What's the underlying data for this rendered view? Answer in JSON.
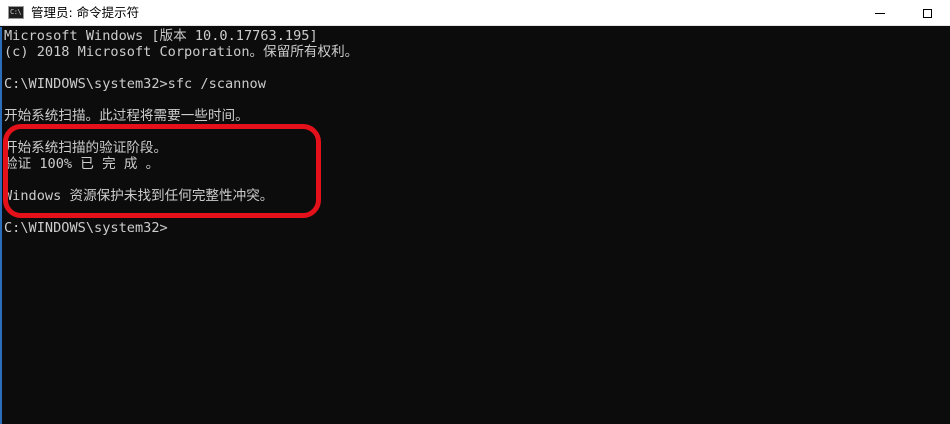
{
  "window": {
    "title": "管理员: 命令提示符",
    "icon_label": "C:\\",
    "icon_name": "console-app-icon",
    "controls": {
      "minimize_icon": "minimize-icon",
      "maximize_icon": "maximize-icon"
    }
  },
  "console": {
    "lines": [
      "Microsoft Windows [版本 10.0.17763.195]",
      "(c) 2018 Microsoft Corporation。保留所有权利。",
      "",
      "C:\\WINDOWS\\system32>sfc /scannow",
      "",
      "开始系统扫描。此过程将需要一些时间。",
      "",
      "开始系统扫描的验证阶段。",
      "验证 100% 已 完 成 。",
      "",
      "Windows 资源保护未找到任何完整性冲突。",
      "",
      "C:\\WINDOWS\\system32>"
    ]
  },
  "colors": {
    "console_background": "#0c0c0c",
    "console_text": "#cccccc",
    "annotation_ring": "#e4101a",
    "titlebar_background": "#ffffff"
  }
}
